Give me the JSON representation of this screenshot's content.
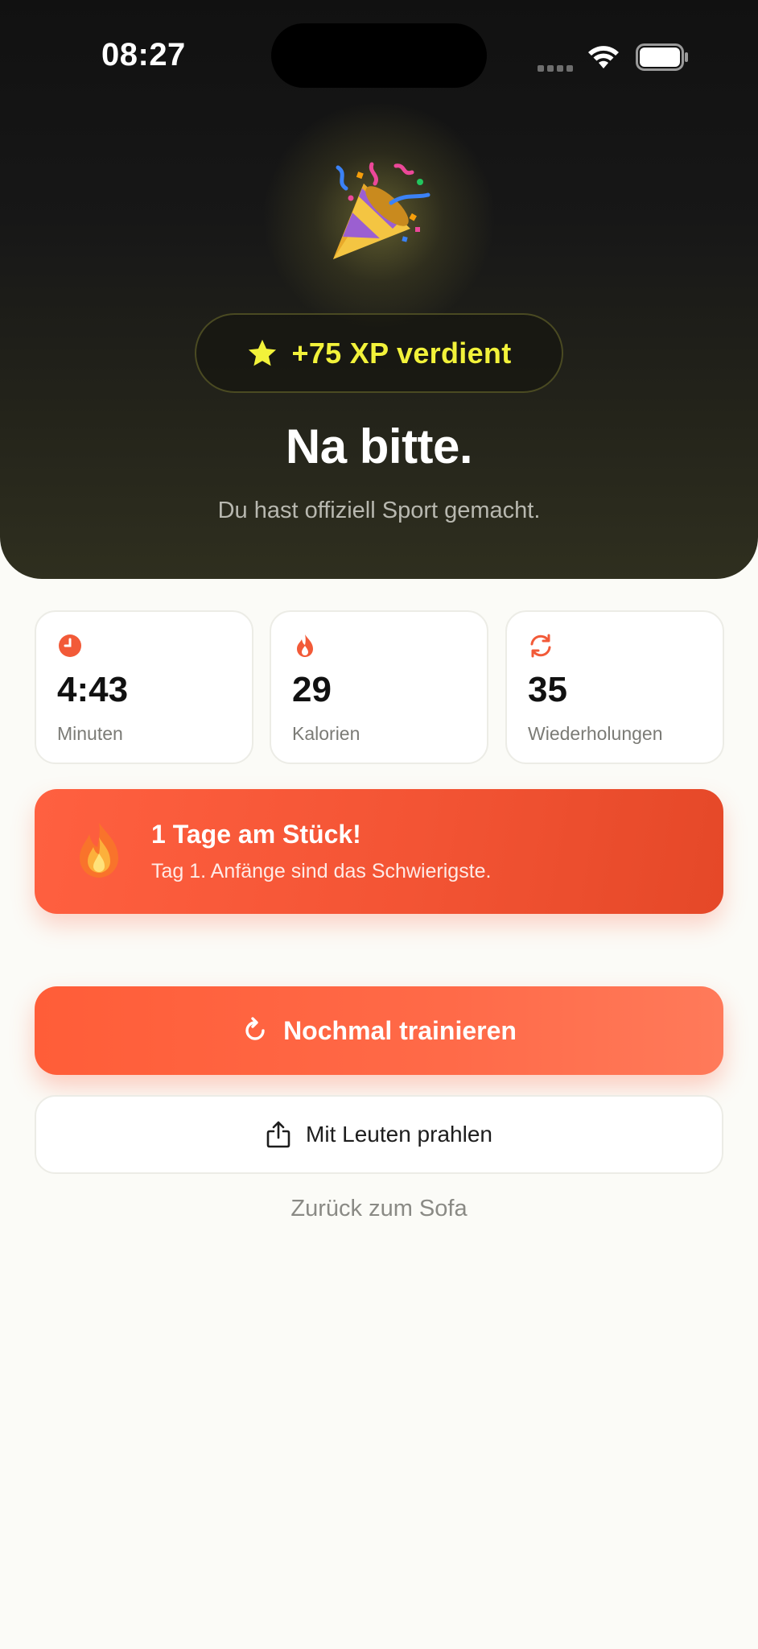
{
  "status_bar": {
    "time": "08:27"
  },
  "hero": {
    "xp_badge": "+75 XP verdient",
    "title": "Na bitte.",
    "subtitle": "Du hast offiziell Sport gemacht.",
    "icon": "party-popper-icon"
  },
  "stats": [
    {
      "value": "4:43",
      "label": "Minuten",
      "icon": "clock-icon"
    },
    {
      "value": "29",
      "label": "Kalorien",
      "icon": "flame-icon"
    },
    {
      "value": "35",
      "label": "Wiederholungen",
      "icon": "repeat-icon"
    }
  ],
  "streak": {
    "title": "1 Tage am Stück!",
    "subtitle": "Tag 1. Anfänge sind das Schwierigste.",
    "icon": "fire-icon"
  },
  "actions": {
    "primary_label": "Nochmal trainieren",
    "secondary_label": "Mit Leuten prahlen",
    "back_label": "Zurück zum Sofa"
  },
  "colors": {
    "accent": "#FF5F3C",
    "xp_yellow": "#F2F23A",
    "hero_dark": "#151515",
    "background": "#FBFBF7"
  }
}
